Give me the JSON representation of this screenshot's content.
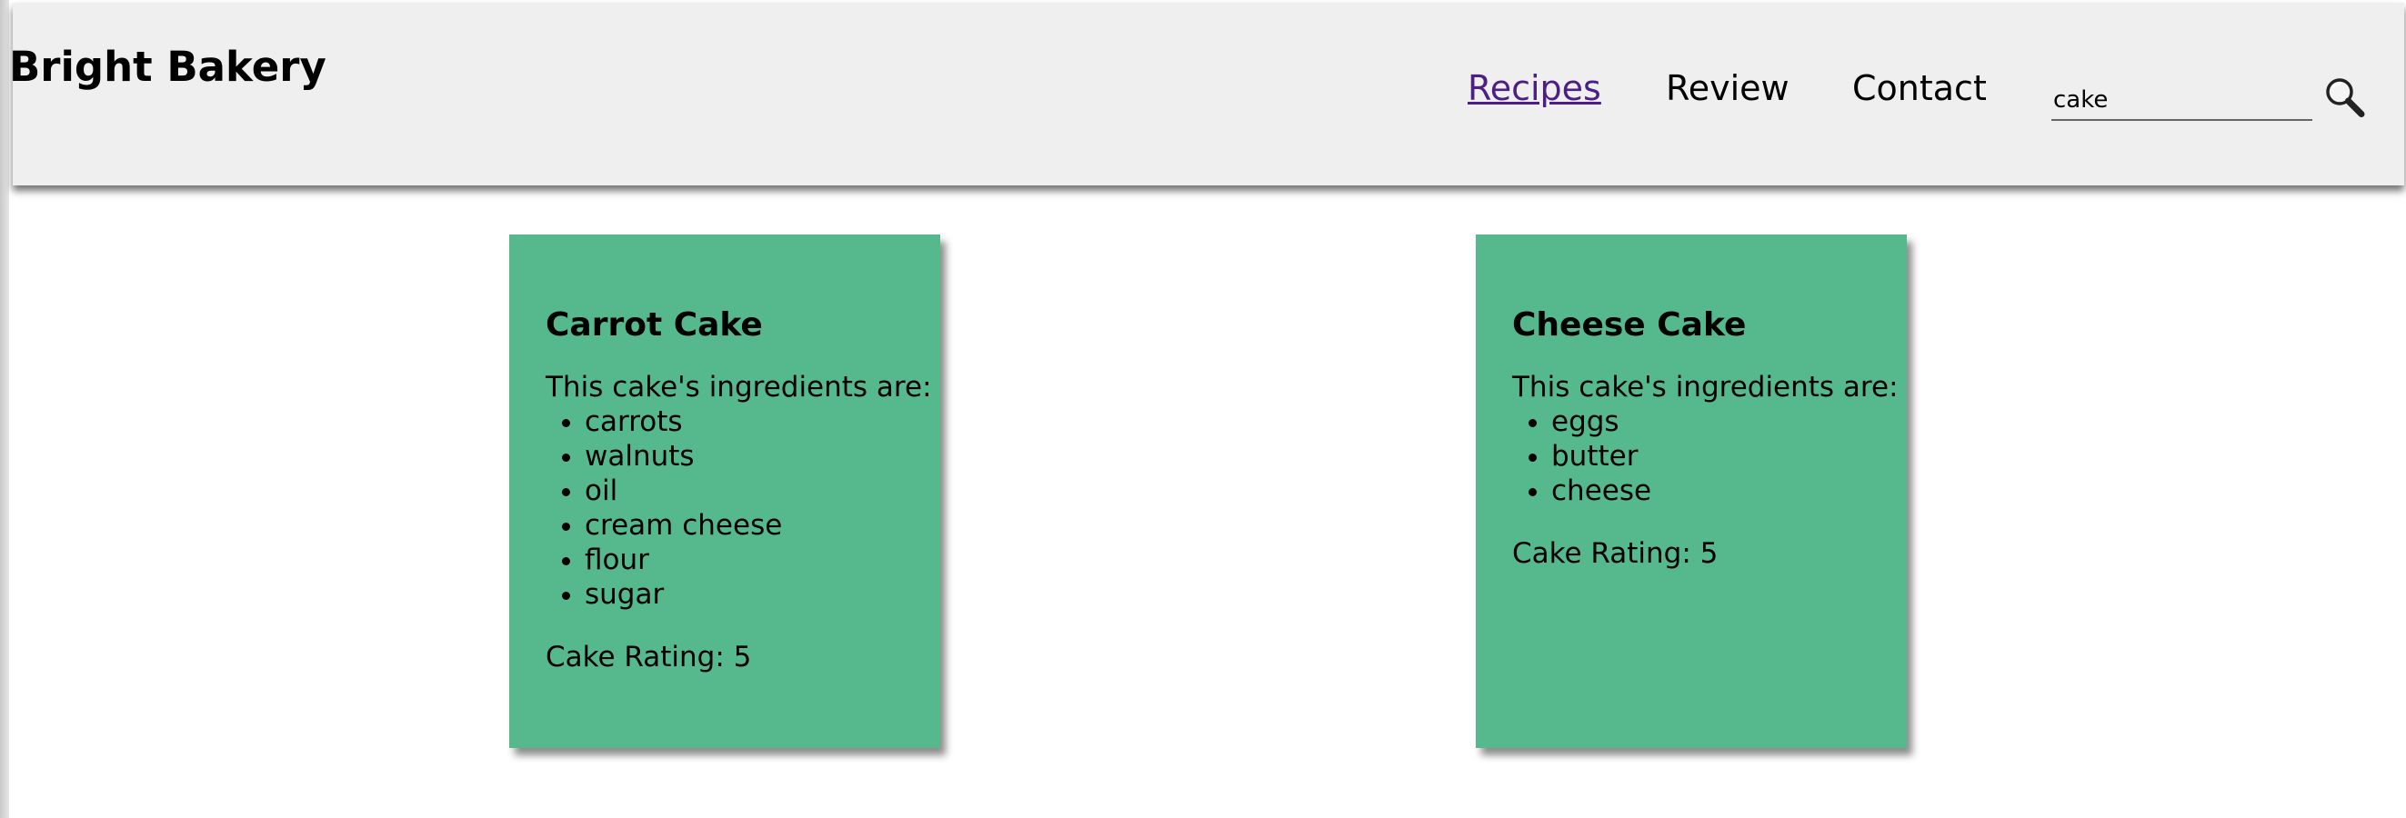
{
  "header": {
    "brand": "Bright Bakery",
    "nav": [
      {
        "label": "Recipes"
      },
      {
        "label": "Review"
      },
      {
        "label": "Contact"
      }
    ],
    "search": {
      "value": "cake",
      "icon": "magnifier-icon"
    }
  },
  "cards": [
    {
      "title": "Carrot Cake",
      "intro": "This cake's ingredients are:",
      "ingredients": [
        "carrots",
        "walnuts",
        "oil",
        "cream cheese",
        "flour",
        "sugar"
      ],
      "rating": "Cake Rating: 5"
    },
    {
      "title": "Cheese Cake",
      "intro": "This cake's ingredients are:",
      "ingredients": [
        "eggs",
        "butter",
        "cheese"
      ],
      "rating": "Cake Rating: 5"
    }
  ],
  "colors": {
    "header_bg": "#efefef",
    "card_bg": "#56b98e",
    "visited_link": "#4b1f86"
  }
}
